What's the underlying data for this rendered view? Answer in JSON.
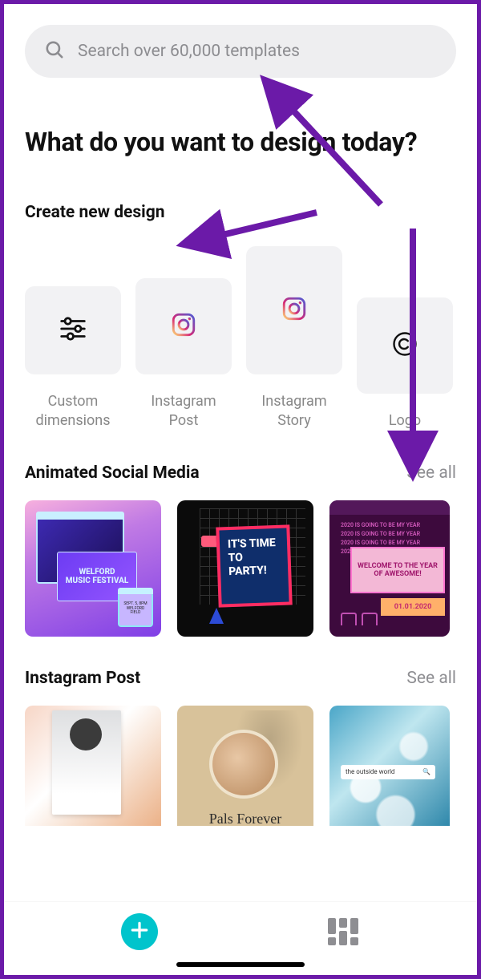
{
  "search": {
    "placeholder": "Search over 60,000 templates"
  },
  "headline": "What do you want to design today?",
  "create_heading": "Create new design",
  "create_items": [
    {
      "label": "Custom dimensions",
      "icon": "sliders-icon"
    },
    {
      "label": "Instagram Post",
      "icon": "instagram-icon"
    },
    {
      "label": "Instagram Story",
      "icon": "instagram-icon"
    },
    {
      "label": "Logo",
      "icon": "copyright-icon"
    }
  ],
  "sections": {
    "animated": {
      "title": "Animated Social Media",
      "see_all": "See all"
    },
    "igpost": {
      "title": "Instagram Post",
      "see_all": "See all"
    }
  },
  "thumbs": {
    "t1_line1": "WELFORD",
    "t1_line2": "MUSIC FESTIVAL",
    "t1_details": "SEPT. 5,\n8PM\nWELFORD FIELD",
    "t2_text": "IT'S TIME TO PARTY!",
    "t3_lines": "2020 IS GOING TO BE MY YEAR\n2020 IS GOING TO BE MY YEAR\n2020 IS GOING TO BE MY YEAR\n2020 IS GOING TO BE MY",
    "t3_panel": "WELCOME TO THE YEAR OF AWESOME!",
    "t3_date": "01.01.2020",
    "ip2_caption": "Pals Forever",
    "ip3_bar": "the outside world"
  },
  "colors": {
    "frame_border": "#6b1aa8",
    "accent_teal": "#00c4cc",
    "ig_gradient_a": "#feda75",
    "ig_gradient_b": "#d62976",
    "ig_gradient_c": "#4f5bd5"
  }
}
